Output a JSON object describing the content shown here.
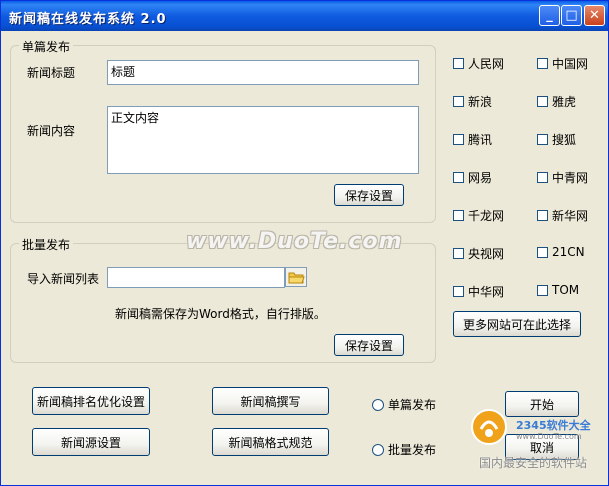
{
  "window": {
    "title": "新闻稿在线发布系统 2.0",
    "controls": {
      "minimize": "_",
      "maximize": "□",
      "close": "✕"
    }
  },
  "single": {
    "legend": "单篇发布",
    "title_label": "新闻标题",
    "title_value": "标题",
    "content_label": "新闻内容",
    "content_value": "正文内容",
    "save_label": "保存设置"
  },
  "batch": {
    "legend": "批量发布",
    "import_label": "导入新闻列表",
    "import_value": "",
    "note": "新闻稿需保存为Word格式，自行排版。",
    "save_label": "保存设置"
  },
  "sites": [
    {
      "label": "人民网",
      "checked": false
    },
    {
      "label": "中国网",
      "checked": false
    },
    {
      "label": "新浪",
      "checked": false
    },
    {
      "label": "雅虎",
      "checked": false
    },
    {
      "label": "腾讯",
      "checked": false
    },
    {
      "label": "搜狐",
      "checked": false
    },
    {
      "label": "网易",
      "checked": false
    },
    {
      "label": "中青网",
      "checked": false
    },
    {
      "label": "千龙网",
      "checked": false
    },
    {
      "label": "新华网",
      "checked": false
    },
    {
      "label": "央视网",
      "checked": false
    },
    {
      "label": "21CN",
      "checked": false
    },
    {
      "label": "中华网",
      "checked": false
    },
    {
      "label": "TOM",
      "checked": false
    }
  ],
  "more_sites_label": "更多网站可在此选择",
  "actions": {
    "seo": "新闻稿排名优化设置",
    "write": "新闻稿撰写",
    "source": "新闻源设置",
    "format": "新闻稿格式规范",
    "start": "开始",
    "cancel": "取消"
  },
  "mode": {
    "single": "单篇发布",
    "batch": "批量发布"
  },
  "overlay": {
    "watermark": "www.DuoTe.com",
    "logo_text": "2345软件大全",
    "logo_url": "www.DuoTe.com",
    "slogan": "国内最安全的软件站"
  },
  "colors": {
    "titlebar": "#0a5ee8",
    "face": "#ece9d8",
    "button_border": "#003c74"
  }
}
